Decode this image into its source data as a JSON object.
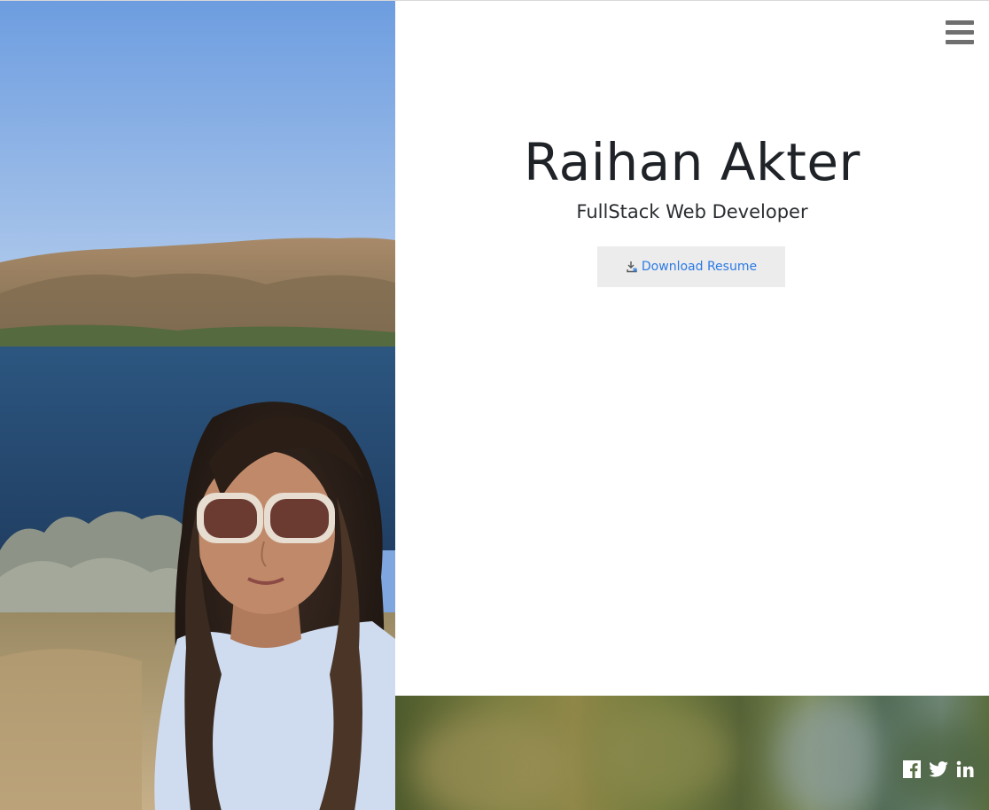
{
  "profile": {
    "name": "Raihan Akter",
    "role": "FullStack Web Developer"
  },
  "actions": {
    "download_label": "Download Resume",
    "download_icon": "download-icon"
  },
  "nav": {
    "menu_icon": "hamburger-menu-icon"
  },
  "socials": [
    {
      "icon": "facebook-icon"
    },
    {
      "icon": "twitter-icon"
    },
    {
      "icon": "linkedin-icon"
    }
  ],
  "colors": {
    "link": "#2c7be5",
    "button_bg": "#ececec",
    "text": "#1f2328",
    "menu_icon": "#6f6f6f"
  }
}
